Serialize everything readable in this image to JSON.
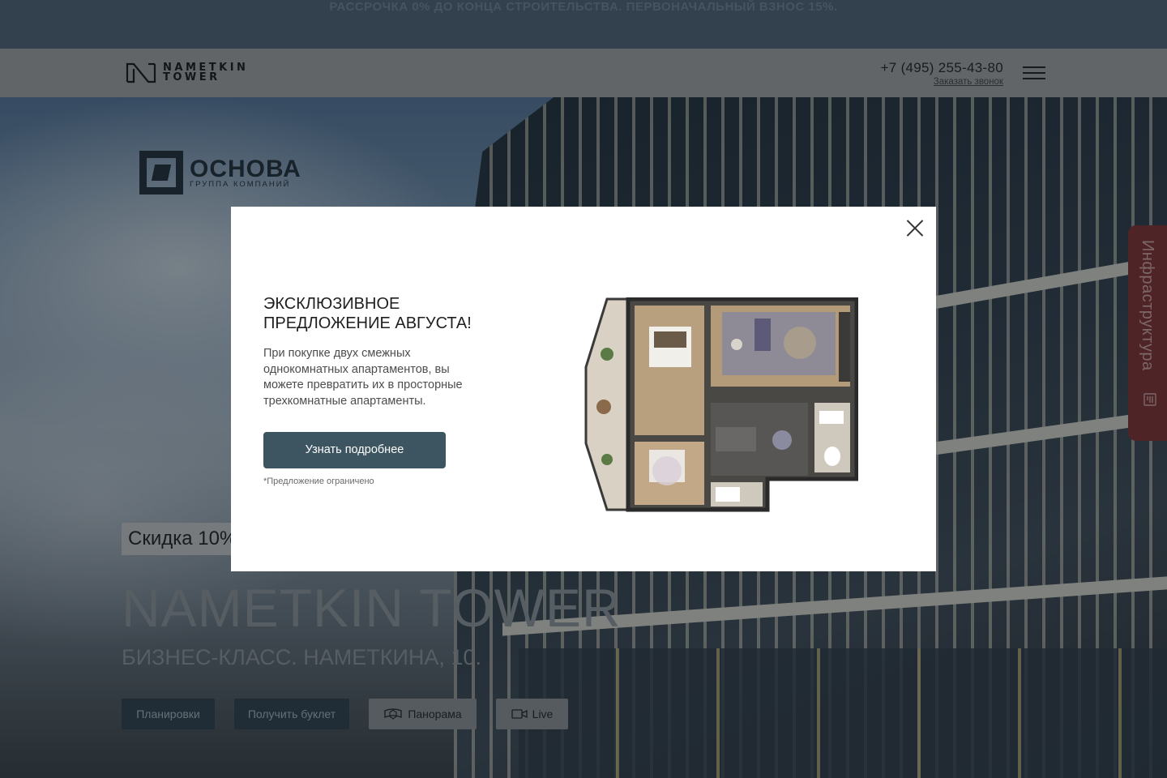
{
  "promo_strip": {
    "text": "РАССРОЧКА 0% ДО КОНЦА СТРОИТЕЛЬСТВА. ПЕРВОНАЧАЛЬНЫЙ ВЗНОС 15%."
  },
  "header": {
    "logo_line1": "NAMETKIN",
    "logo_line2": "TOWER",
    "phone": "+7 (495) 255-43-80",
    "callback_label": "Заказать звонок"
  },
  "developer": {
    "name": "ОСНОВА",
    "subtitle": "ГРУППА КОМПАНИЙ"
  },
  "hero": {
    "discount_badge": "Скидка 10%",
    "title": "NAMETKIN TOWER",
    "subtitle": "БИЗНЕС-КЛАСС. НАМЕТКИНА, 10.",
    "buttons": {
      "plans": "Планировки",
      "booklet": "Получить буклет",
      "panorama": "Панорама",
      "live": "Live"
    }
  },
  "side_tab": {
    "label": "Инфраструктура",
    "icon": "map-info-icon"
  },
  "modal": {
    "title": "Эксклюзивное предложение августа!",
    "text": "При покупке двух смежных однокомнатных апартаментов, вы можете превратить их в просторные трехкомнатные апартаменты.",
    "button_label": "Узнать подробнее",
    "note": "*Предложение ограничено"
  },
  "colors": {
    "modal_button": "#3c5560",
    "side_tab": "#7e2a29",
    "dark_button": "#2a3a46"
  }
}
